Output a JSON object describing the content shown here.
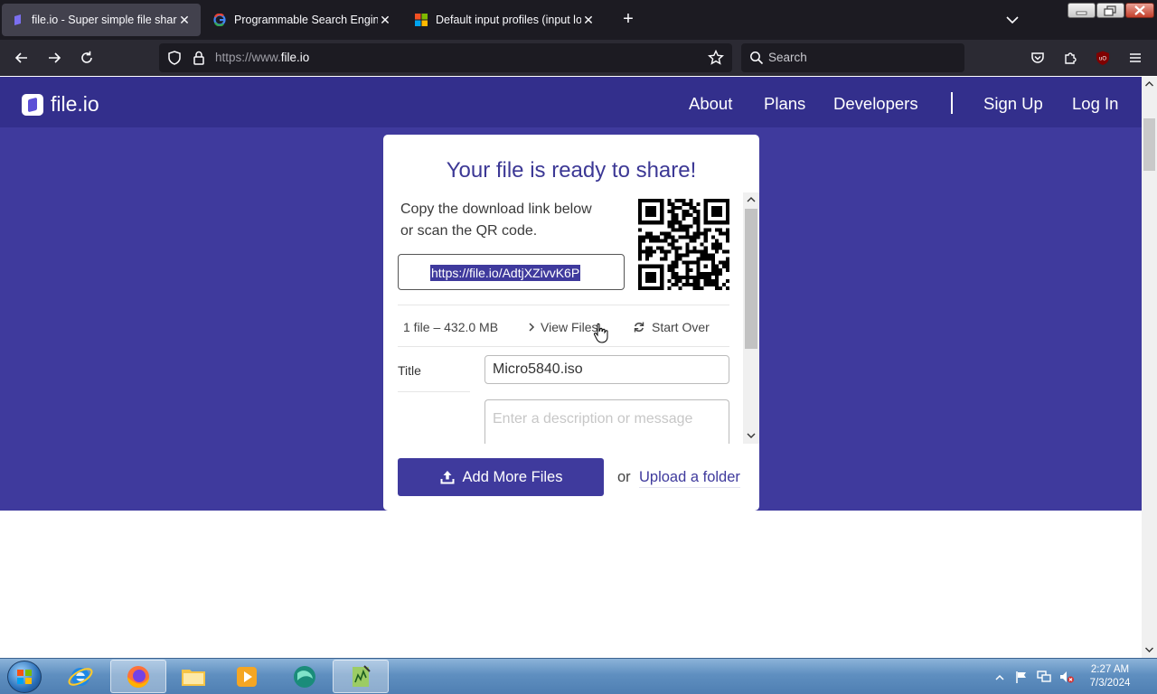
{
  "browser": {
    "tabs": [
      {
        "title": "file.io - Super simple file sharing",
        "icon": "fileio-icon",
        "active": true
      },
      {
        "title": "Programmable Search Engine",
        "icon": "google-icon",
        "active": false
      },
      {
        "title": "Default input profiles (input loc",
        "icon": "microsoft-icon",
        "active": false
      }
    ],
    "url_prefix": "https://www.",
    "url_domain": "file.io",
    "search_placeholder": "Search"
  },
  "site": {
    "logo_text": "file.io",
    "nav": [
      "About",
      "Plans",
      "Developers",
      "Sign Up",
      "Log In"
    ],
    "card": {
      "title": "Your file is ready to share!",
      "copy_line1": "Copy the download link below",
      "copy_line2": "or scan the QR code.",
      "link": "https://file.io/AdtjXZivvK6P",
      "file_info": "1 file – 432.0 MB",
      "view_files": "View Files",
      "start_over": "Start Over",
      "title_label": "Title",
      "title_value": "Micro5840.iso",
      "description_placeholder": "Enter a description or message",
      "add_button": "Add More Files",
      "or_text": "or",
      "upload_folder": "Upload a folder"
    }
  },
  "taskbar": {
    "time": "2:27 AM",
    "date": "7/3/2024"
  },
  "colors": {
    "brand": "#3f3a9d",
    "header": "#332f8c",
    "browser_dark": "#1c1b22"
  }
}
